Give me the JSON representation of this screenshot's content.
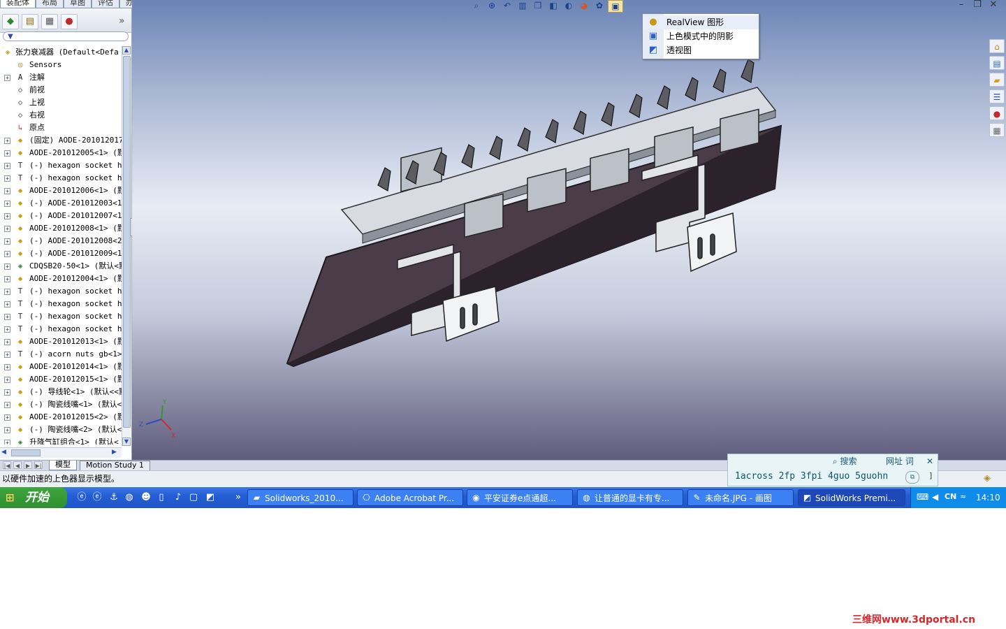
{
  "command_tabs": [
    "装配体",
    "布局",
    "草图",
    "评估",
    "办公室产品"
  ],
  "feature_manager": {
    "filter_label": "▼",
    "expand_label": "»",
    "tree": [
      {
        "label": "张力衰减器  (Default<Defa",
        "icon": "assembly-icon",
        "expand": "",
        "indent": 0
      },
      {
        "label": "Sensors",
        "icon": "sensor-icon",
        "expand": "",
        "indent": 1
      },
      {
        "label": "注解",
        "icon": "annotation-icon",
        "expand": "+",
        "indent": 1
      },
      {
        "label": "前视",
        "icon": "plane-icon",
        "expand": "",
        "indent": 1
      },
      {
        "label": "上视",
        "icon": "plane-icon",
        "expand": "",
        "indent": 1
      },
      {
        "label": "右视",
        "icon": "plane-icon",
        "expand": "",
        "indent": 1
      },
      {
        "label": "原点",
        "icon": "origin-icon",
        "expand": "",
        "indent": 1
      },
      {
        "label": "(固定) AODE-201012017<",
        "icon": "part-icon",
        "expand": "+",
        "indent": 1
      },
      {
        "label": "AODE-201012005<1> (默认",
        "icon": "part-icon",
        "expand": "+",
        "indent": 1
      },
      {
        "label": "(-) hexagon socket hea",
        "icon": "bolt-icon",
        "expand": "+",
        "indent": 1
      },
      {
        "label": "(-) hexagon socket hea",
        "icon": "bolt-icon",
        "expand": "+",
        "indent": 1
      },
      {
        "label": "AODE-201012006<1> (默认",
        "icon": "part-icon",
        "expand": "+",
        "indent": 1
      },
      {
        "label": "(-) AODE-201012003<1>",
        "icon": "part-icon",
        "expand": "+",
        "indent": 1
      },
      {
        "label": "(-) AODE-201012007<1>",
        "icon": "part-icon",
        "expand": "+",
        "indent": 1
      },
      {
        "label": "AODE-201012008<1> (默认",
        "icon": "part-icon",
        "expand": "+",
        "indent": 1
      },
      {
        "label": "(-) AODE-201012008<2>",
        "icon": "part-icon",
        "expand": "+",
        "indent": 1
      },
      {
        "label": "(-) AODE-201012009<1>",
        "icon": "part-icon",
        "expand": "+",
        "indent": 1
      },
      {
        "label": "CDQSB20-50<1> (默认<默",
        "icon": "subassembly-icon",
        "expand": "+",
        "indent": 1
      },
      {
        "label": "AODE-201012004<1> (默认",
        "icon": "part-icon",
        "expand": "+",
        "indent": 1
      },
      {
        "label": "(-) hexagon socket hea",
        "icon": "bolt-icon",
        "expand": "+",
        "indent": 1
      },
      {
        "label": "(-) hexagon socket hea",
        "icon": "bolt-icon",
        "expand": "+",
        "indent": 1
      },
      {
        "label": "(-) hexagon socket hea",
        "icon": "bolt-icon",
        "expand": "+",
        "indent": 1
      },
      {
        "label": "(-) hexagon socket hea",
        "icon": "bolt-icon",
        "expand": "+",
        "indent": 1
      },
      {
        "label": "AODE-201012013<1> (默认",
        "icon": "part-icon",
        "expand": "+",
        "indent": 1
      },
      {
        "label": "(-) acorn nuts gb<1>",
        "icon": "bolt-icon",
        "expand": "+",
        "indent": 1
      },
      {
        "label": "AODE-201012014<1> (默认",
        "icon": "part-icon",
        "expand": "+",
        "indent": 1
      },
      {
        "label": "AODE-201012015<1> (默认",
        "icon": "part-icon",
        "expand": "+",
        "indent": 1
      },
      {
        "label": "(-) 导线轮<1> (默认<<默",
        "icon": "part-icon",
        "expand": "+",
        "indent": 1
      },
      {
        "label": "(-) 陶瓷线嘴<1> (默认<",
        "icon": "part-icon",
        "expand": "+",
        "indent": 1
      },
      {
        "label": "AODE-201012015<2> (默认",
        "icon": "part-icon",
        "expand": "+",
        "indent": 1
      },
      {
        "label": "(-) 陶瓷线嘴<2> (默认<",
        "icon": "part-icon",
        "expand": "+",
        "indent": 1
      },
      {
        "label": "升降气缸组合<1> (默认<",
        "icon": "subassembly-icon",
        "expand": "+",
        "indent": 1
      }
    ]
  },
  "display_menu": {
    "items": [
      {
        "label": "RealView 图形",
        "icon": "realview-icon"
      },
      {
        "label": "上色模式中的阴影",
        "icon": "shadow-icon"
      },
      {
        "label": "透视图",
        "icon": "perspective-icon"
      }
    ]
  },
  "triad": {
    "x": "X",
    "y": "Y",
    "z": "Z"
  },
  "bottom_tabs": [
    "模型",
    "Motion Study 1"
  ],
  "status": {
    "text": "以硬件加速的上色器显示模型。"
  },
  "ime": {
    "search_label": "搜索",
    "web_label": "网址 词",
    "close_label": "✕",
    "candidates": "1across 2fp 3fpi 4guo 5guohn"
  },
  "taskbar": {
    "start_label": "开始",
    "tasks": [
      {
        "label": "Solidworks_2010...",
        "icon": "folder-icon"
      },
      {
        "label": "Adobe Acrobat Pr...",
        "icon": "acrobat-icon"
      },
      {
        "label": "平安证券e点通超...",
        "icon": "stock-app-icon"
      },
      {
        "label": "让普通的显卡有专...",
        "icon": "browser-icon"
      },
      {
        "label": "未命名.JPG - 画图",
        "icon": "paint-icon"
      },
      {
        "label": "SolidWorks Premi...",
        "icon": "solidworks-icon"
      }
    ],
    "clock": "14:10"
  },
  "watermark": "三维网www.3dportal.cn"
}
